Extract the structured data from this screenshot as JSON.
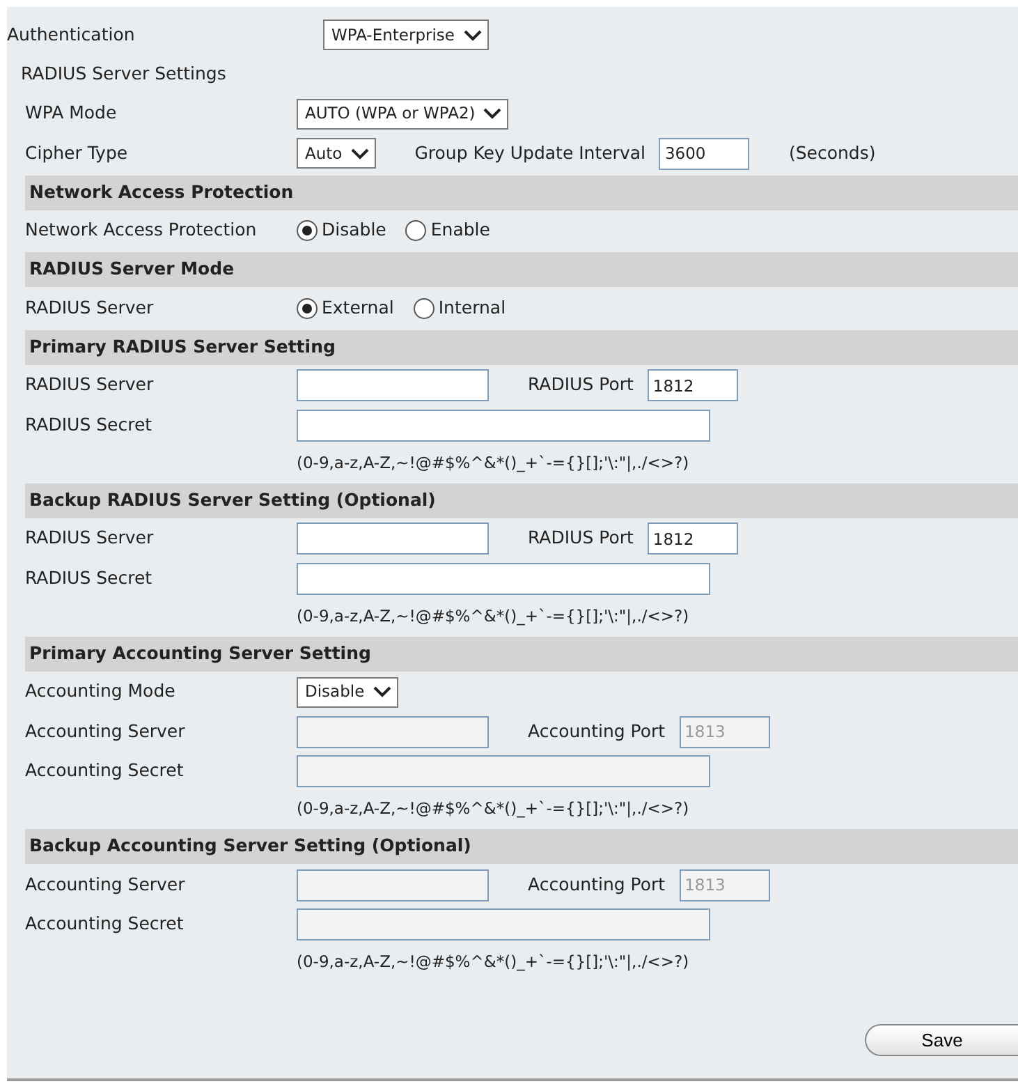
{
  "rows": [
    {
      "kind": "field",
      "indent": false,
      "label": "Authentication",
      "controls": [
        {
          "kind": "select",
          "value": "WPA-Enterprise"
        }
      ]
    },
    {
      "kind": "subtitle",
      "text": "RADIUS Server Settings"
    },
    {
      "kind": "field",
      "indent": true,
      "label": "WPA Mode",
      "controls": [
        {
          "kind": "select",
          "value": "AUTO (WPA or WPA2)"
        }
      ]
    },
    {
      "kind": "field",
      "indent": true,
      "label": "Cipher Type",
      "controls": [
        {
          "kind": "select",
          "value": "Auto"
        },
        {
          "kind": "text",
          "text": "Group Key Update Interval"
        },
        {
          "kind": "port",
          "value": "3600",
          "disabled": false
        },
        {
          "kind": "text",
          "text": "(Seconds)"
        }
      ]
    },
    {
      "kind": "section",
      "text": "Network Access Protection"
    },
    {
      "kind": "field",
      "indent": true,
      "label": "Network Access Protection",
      "controls": [
        {
          "kind": "radio",
          "options": [
            {
              "label": "Disable",
              "selected": true
            },
            {
              "label": "Enable",
              "selected": false
            }
          ]
        }
      ]
    },
    {
      "kind": "section",
      "text": "RADIUS Server Mode"
    },
    {
      "kind": "field",
      "indent": true,
      "label": "RADIUS Server",
      "controls": [
        {
          "kind": "radio",
          "options": [
            {
              "label": "External",
              "selected": true
            },
            {
              "label": "Internal",
              "selected": false
            }
          ]
        }
      ]
    },
    {
      "kind": "section",
      "text": "Primary RADIUS Server Setting"
    },
    {
      "kind": "field",
      "indent": true,
      "label": "RADIUS Server",
      "controls": [
        {
          "kind": "server",
          "disabled": false
        },
        {
          "kind": "text",
          "text": "RADIUS Port"
        },
        {
          "kind": "port",
          "value": "1812",
          "disabled": false
        }
      ]
    },
    {
      "kind": "field",
      "indent": true,
      "label": "RADIUS Secret",
      "controls": [
        {
          "kind": "secret",
          "disabled": false
        }
      ]
    },
    {
      "kind": "hint",
      "text": "(0-9,a-z,A-Z,~!@#$%^&*()_+`-={}[];'\\:\"|,./<>?)"
    },
    {
      "kind": "section",
      "text": "Backup RADIUS Server Setting (Optional)"
    },
    {
      "kind": "field",
      "indent": true,
      "label": "RADIUS Server",
      "controls": [
        {
          "kind": "server",
          "disabled": false
        },
        {
          "kind": "text",
          "text": "RADIUS Port"
        },
        {
          "kind": "port",
          "value": "1812",
          "disabled": false
        }
      ]
    },
    {
      "kind": "field",
      "indent": true,
      "label": "RADIUS Secret",
      "controls": [
        {
          "kind": "secret",
          "disabled": false
        }
      ]
    },
    {
      "kind": "hint",
      "text": "(0-9,a-z,A-Z,~!@#$%^&*()_+`-={}[];'\\:\"|,./<>?)"
    },
    {
      "kind": "section",
      "text": "Primary Accounting Server Setting"
    },
    {
      "kind": "field",
      "indent": true,
      "label": "Accounting Mode",
      "controls": [
        {
          "kind": "select",
          "value": "Disable"
        }
      ]
    },
    {
      "kind": "field",
      "indent": true,
      "label": "Accounting Server",
      "controls": [
        {
          "kind": "server",
          "disabled": true
        },
        {
          "kind": "text",
          "text": "Accounting Port"
        },
        {
          "kind": "port",
          "value": "1813",
          "disabled": true
        }
      ]
    },
    {
      "kind": "field",
      "indent": true,
      "label": "Accounting Secret",
      "controls": [
        {
          "kind": "secret",
          "disabled": true
        }
      ]
    },
    {
      "kind": "hint",
      "text": "(0-9,a-z,A-Z,~!@#$%^&*()_+`-={}[];'\\:\"|,./<>?)"
    },
    {
      "kind": "section",
      "text": "Backup Accounting Server Setting (Optional)"
    },
    {
      "kind": "field",
      "indent": true,
      "label": "Accounting Server",
      "controls": [
        {
          "kind": "server",
          "disabled": true
        },
        {
          "kind": "text",
          "text": "Accounting Port"
        },
        {
          "kind": "port",
          "value": "1813",
          "disabled": true
        }
      ]
    },
    {
      "kind": "field",
      "indent": true,
      "label": "Accounting Secret",
      "controls": [
        {
          "kind": "secret",
          "disabled": true
        }
      ]
    },
    {
      "kind": "hint",
      "text": "(0-9,a-z,A-Z,~!@#$%^&*()_+`-={}[];'\\:\"|,./<>?)"
    }
  ],
  "save_button": "Save"
}
